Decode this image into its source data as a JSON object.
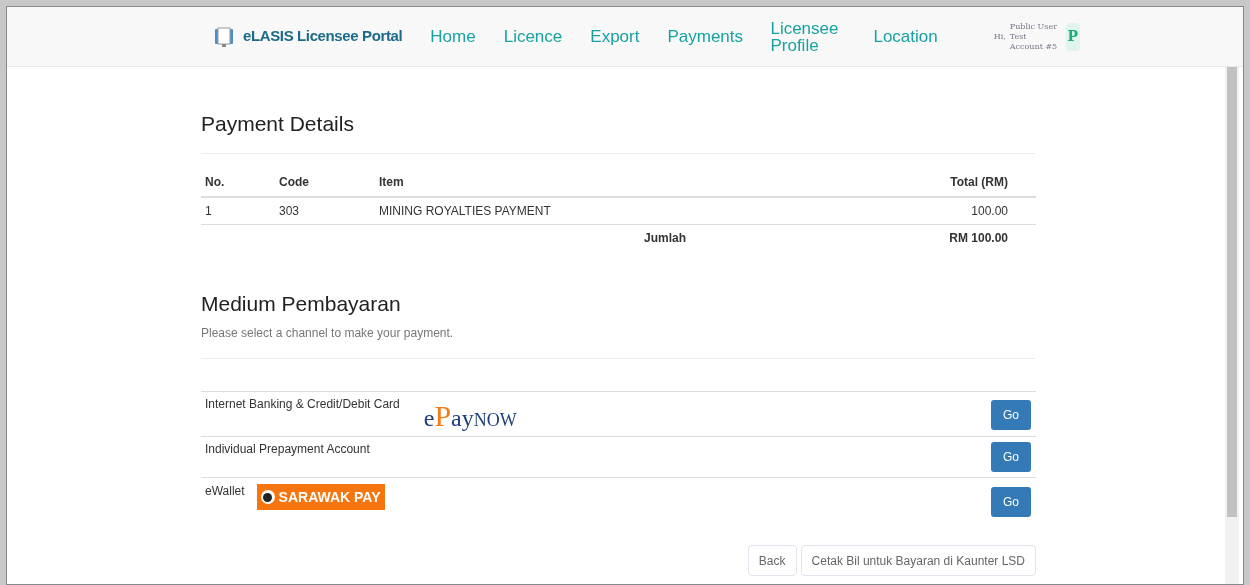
{
  "brand": "eLASIS Licensee Portal",
  "nav": [
    {
      "label": "Home"
    },
    {
      "label": "Licence"
    },
    {
      "label": "Export"
    },
    {
      "label": "Payments"
    },
    {
      "label": "Licensee Profile"
    },
    {
      "label": "Location"
    }
  ],
  "user": {
    "greeting": "Hi,",
    "name": "Public User Test Account #5",
    "avatar": "P"
  },
  "payment_details": {
    "title": "Payment Details",
    "columns": [
      "No.",
      "Code",
      "Item",
      "Total (RM)"
    ],
    "rows": [
      [
        "1",
        "303",
        "MINING ROYALTIES PAYMENT",
        "100.00"
      ]
    ],
    "total_label": "Jumlah",
    "total_value": "RM 100.00"
  },
  "medium": {
    "title": "Medium Pembayaran",
    "subtitle": "Please select a channel to make your payment.",
    "channels": [
      {
        "label": "Internet Banking & Credit/Debit Card",
        "kind": "epaynow",
        "logo_text": "ePayNOW",
        "button": "Go"
      },
      {
        "label": "Individual Prepayment Account",
        "kind": "plain",
        "button": "Go"
      },
      {
        "label": "eWallet",
        "kind": "sarawakpay",
        "logo_text": "SARAWAK PAY",
        "button": "Go"
      }
    ]
  },
  "buttons": [
    "Back",
    "Cetak Bil untuk Bayaran di Kaunter LSD"
  ]
}
